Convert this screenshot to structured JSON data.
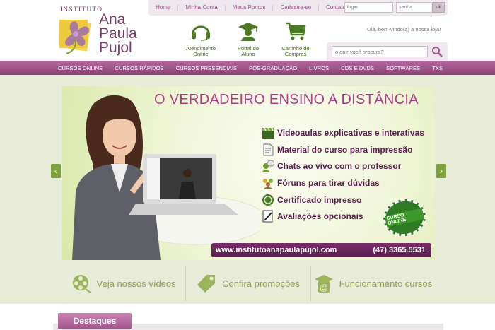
{
  "logo": {
    "institute": "INSTITUTO",
    "name_lines": [
      "Ana",
      "Paula",
      "Pujol"
    ]
  },
  "topnav": {
    "links": [
      "Home",
      "Minha Conta",
      "Meus Pontos",
      "Cadastre-se",
      "Contato"
    ],
    "login_placeholder": "login",
    "password_placeholder": "senha",
    "ok_label": "ok"
  },
  "quick_links": [
    {
      "label_lines": [
        "Atendimento",
        "Online"
      ],
      "icon": "headset-icon"
    },
    {
      "label_lines": [
        "Portal do",
        "Aluno"
      ],
      "icon": "graduate-icon"
    },
    {
      "label_lines": [
        "Carrinho de",
        "Compras"
      ],
      "icon": "cart-icon"
    }
  ],
  "greeting": "Olá, bem-vindo(a) a nossa loja!",
  "search": {
    "placeholder": "o que você procura?"
  },
  "mainnav": [
    "CURSOS ONLINE",
    "CURSOS RÁPIDOS",
    "CURSOS PRESENCIAIS",
    "PÓS-GRADUAÇÃO",
    "LIVROS",
    "CDS E DVDS",
    "SOFTWARES",
    "TXS"
  ],
  "banner": {
    "title": "O VERDADEIRO ENSINO A DISTÂNCIA",
    "features": [
      "Videoaulas explicativas e interativas",
      "Material do curso para impressão",
      "Chats ao vivo com o professor",
      "Fóruns para tirar dúvidas",
      "Certificado impresso",
      "Avaliações opcionais"
    ],
    "seal": "CURSO ONLINE",
    "url": "www.institutoanapaulapujol.com",
    "phone": "(47) 3365.5531"
  },
  "slider": {
    "prev": "‹",
    "next": "›"
  },
  "actions": [
    {
      "label": "Veja nossos vídeos",
      "icon": "film-reel-icon"
    },
    {
      "label": "Confira promoções",
      "icon": "tag-icon"
    },
    {
      "label": "Funcionamento cursos",
      "icon": "graduate-at-icon"
    }
  ],
  "destaques": "Destaques",
  "colors": {
    "brand_purple": "#8f3f78",
    "accent_green": "#8da44c",
    "stage_bg": "#e8ebd8"
  }
}
